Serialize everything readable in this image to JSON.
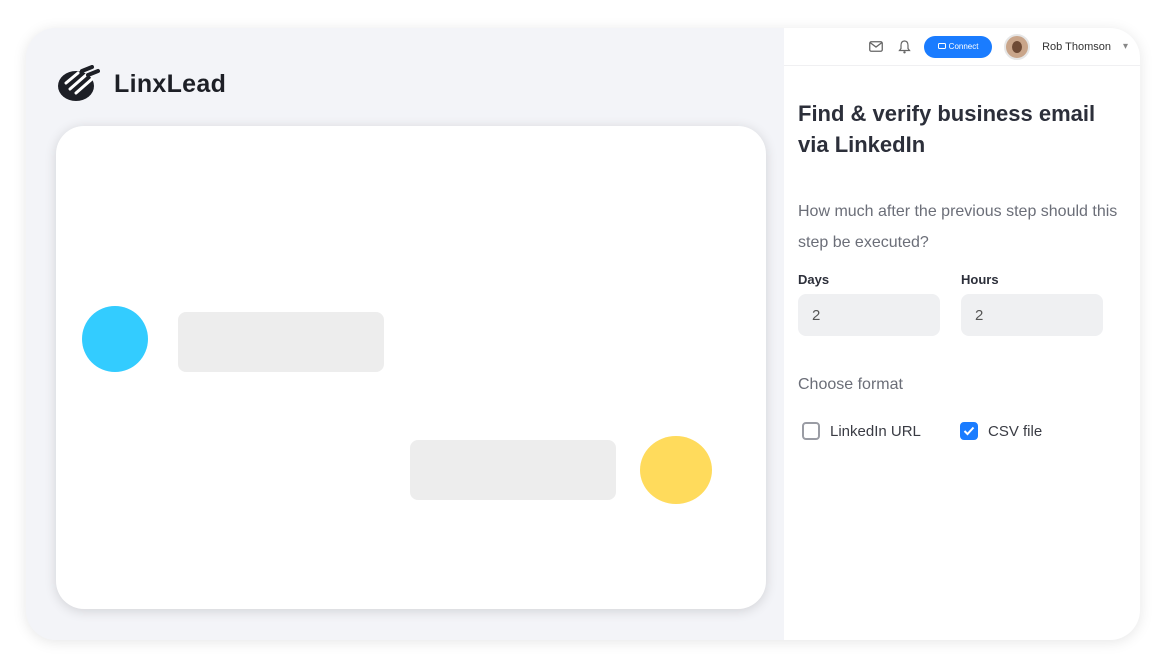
{
  "brand": {
    "name": "LinxLead"
  },
  "topbar": {
    "connect_label": "Connect",
    "user_name": "Rob Thomson"
  },
  "panel": {
    "title": "Find & verify business email via LinkedIn",
    "question": "How much after the previous step should this step be executed?",
    "days": {
      "label": "Days",
      "value": "2"
    },
    "hours": {
      "label": "Hours",
      "value": "2"
    },
    "format_label": "Choose format",
    "options": [
      {
        "label": "LinkedIn URL",
        "checked": false
      },
      {
        "label": "CSV file",
        "checked": true
      }
    ]
  },
  "colors": {
    "accent": "#1a7cff",
    "contact_circle": "#33ccff",
    "user_circle": "#ffdb5c",
    "placeholder": "#ededed"
  },
  "icons": [
    "mail-icon",
    "bell-icon",
    "link-icon",
    "chevron-down-icon",
    "check-icon"
  ]
}
